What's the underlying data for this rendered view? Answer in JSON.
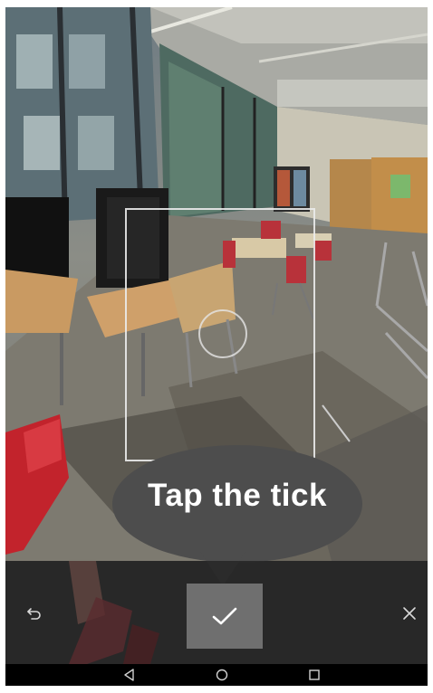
{
  "hint": {
    "text": "Tap the tick"
  },
  "controls": {
    "undo_icon": "undo-icon",
    "confirm_icon": "check-icon",
    "close_icon": "close-icon"
  },
  "navbar": {
    "back_icon": "back-triangle-icon",
    "home_icon": "home-circle-icon",
    "recents_icon": "recents-square-icon"
  },
  "colors": {
    "hint_bubble": "#4d4d4d",
    "control_bar": "#282828",
    "confirm_button": "#6f6f6f",
    "nav_bar": "#000000"
  }
}
